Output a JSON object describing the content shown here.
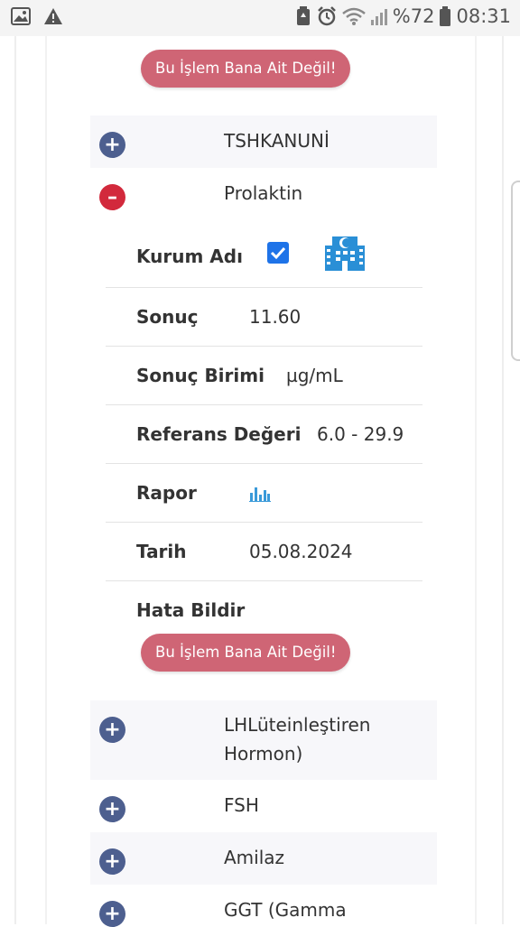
{
  "status_bar": {
    "left_icons": [
      "image-icon",
      "warning-icon"
    ],
    "right_icons": [
      "battery-saver-icon",
      "alarm-icon",
      "wifi-icon",
      "signal-icon"
    ],
    "battery": "%72",
    "time": "08:31"
  },
  "buttons": {
    "not_mine_label": "Bu İşlem Bana Ait Değil!"
  },
  "accordion": {
    "items": [
      {
        "title": "TSHKANUNİ",
        "state": "collapsed"
      },
      {
        "title": "Prolaktin",
        "state": "expanded"
      },
      {
        "title": "LHLüteinleştiren Hormon)",
        "state": "collapsed"
      },
      {
        "title": "FSH",
        "state": "collapsed"
      },
      {
        "title": "Amilaz",
        "state": "collapsed"
      },
      {
        "title": "GGT (Gamma",
        "state": "collapsed"
      }
    ]
  },
  "detail": {
    "institution_label": "Kurum Adı",
    "institution_checked": true,
    "institution_icon": "hospital-icon",
    "result_label": "Sonuç",
    "result_value": "11.60",
    "unit_label": "Sonuç Birimi",
    "unit_value": "µg/mL",
    "reference_label": "Referans Değeri",
    "reference_value": "6.0 - 29.9",
    "report_label": "Rapor",
    "report_icon": "bar-chart-icon",
    "date_label": "Tarih",
    "date_value": "05.08.2024",
    "error_label": "Hata Bildir"
  },
  "colors": {
    "button_bg": "#cf6575",
    "plus_icon": "#4d5f8f",
    "minus_icon": "#d2293c",
    "checkbox": "#1e73e8",
    "hospital_icon": "#2a8fd6"
  }
}
